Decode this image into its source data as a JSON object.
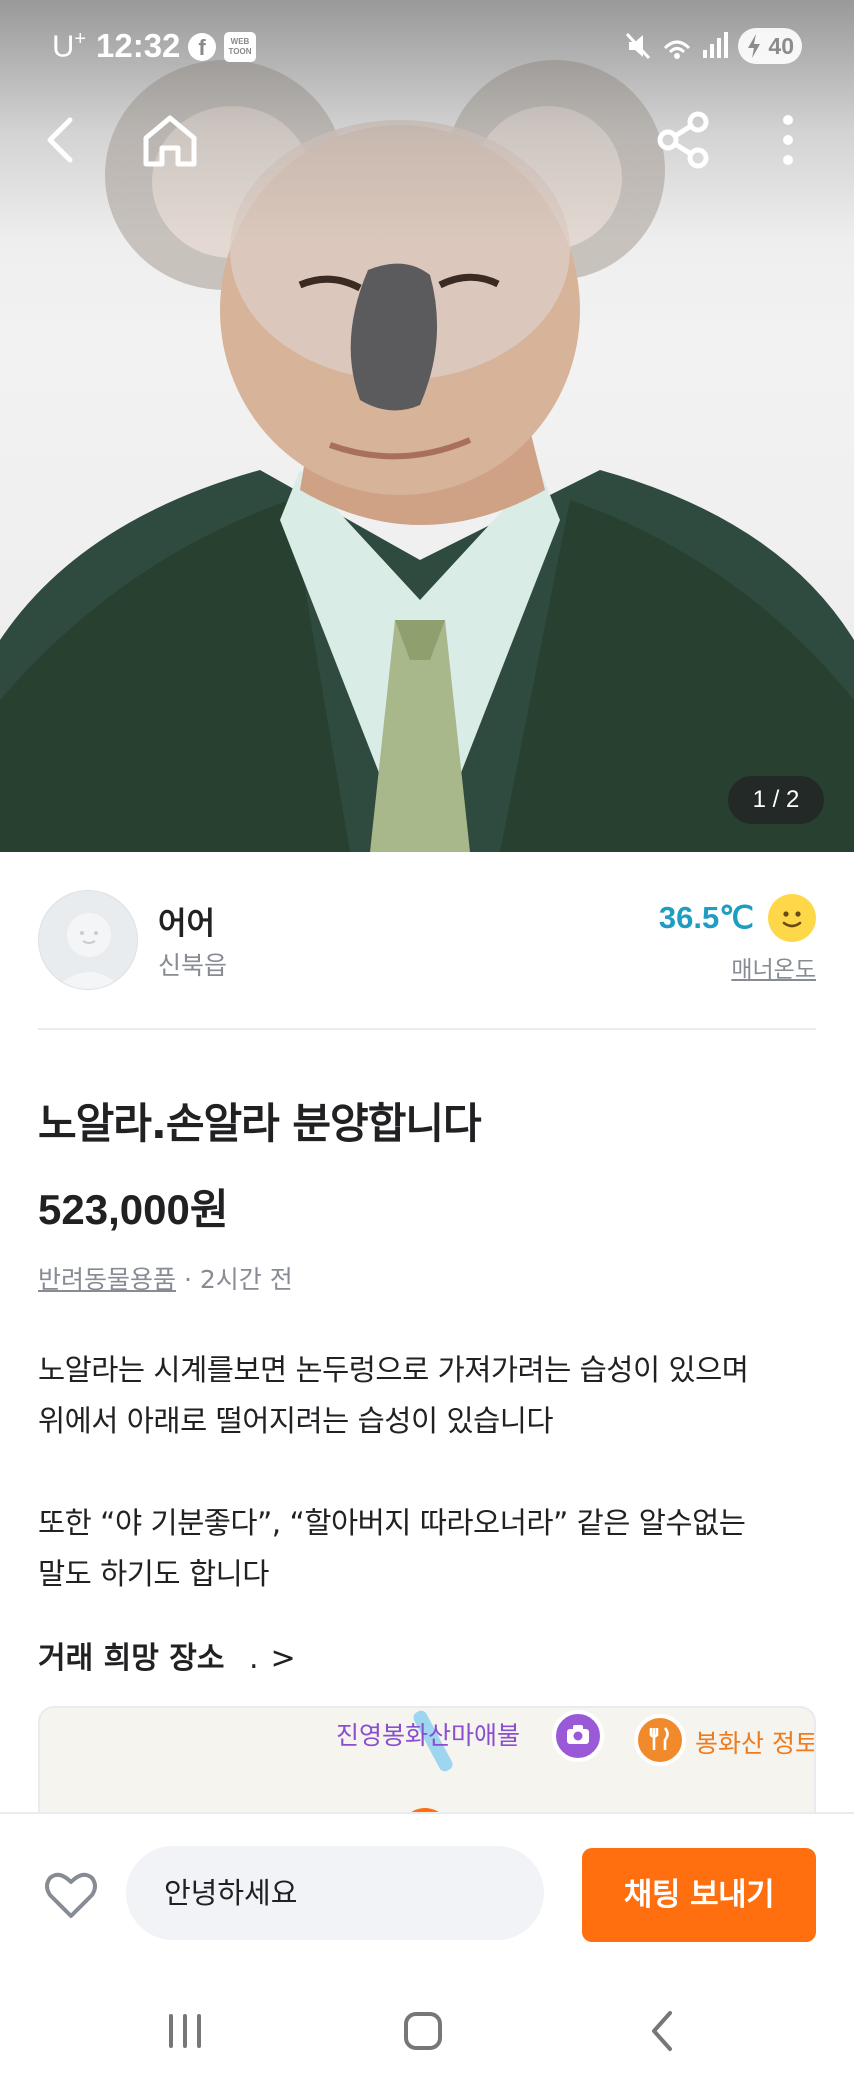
{
  "status_bar": {
    "carrier": "U",
    "carrier_mark": "+",
    "time": "12:32",
    "facebook_glyph": "f",
    "webtoon_label": "WEB TOON",
    "battery": "40"
  },
  "header": {
    "back_icon": "back-arrow-icon",
    "home_icon": "home-icon",
    "share_icon": "share-icon",
    "more_icon": "more-vertical-icon"
  },
  "gallery": {
    "counter": "1 / 2",
    "current": 1,
    "total": 2
  },
  "seller": {
    "name": "어어",
    "location": "신북읍",
    "manner_temp": "36.5℃",
    "manner_label": "매너온도"
  },
  "product": {
    "title": "노알라.손알라 분양합니다",
    "price": "523,000원",
    "category": "반려동물용품",
    "separator": " · ",
    "posted": "2시간 전",
    "description": [
      "노알라는 시계를보면 논두렁으로 가져가려는 습성이 있으며",
      "위에서 아래로 떨어지려는 습성이 있습니다",
      "또한 “야 기분좋다”, “할아버지 따라오너라” 같은 알수없는",
      "말도 하기도 합니다"
    ]
  },
  "trade_place": {
    "label": "거래 희망 장소",
    "value": ".",
    "chevron": ">",
    "map": {
      "label_1": "진영봉화산마애불",
      "label_2": "봉화산 정토"
    }
  },
  "action_bar": {
    "message_value": "안녕하세요",
    "chat_button": "채팅 보내기"
  },
  "colors": {
    "accent": "#ff6f0f",
    "manner_blue": "#1d9dc2",
    "text_primary": "#212124",
    "text_secondary": "#868b94"
  }
}
